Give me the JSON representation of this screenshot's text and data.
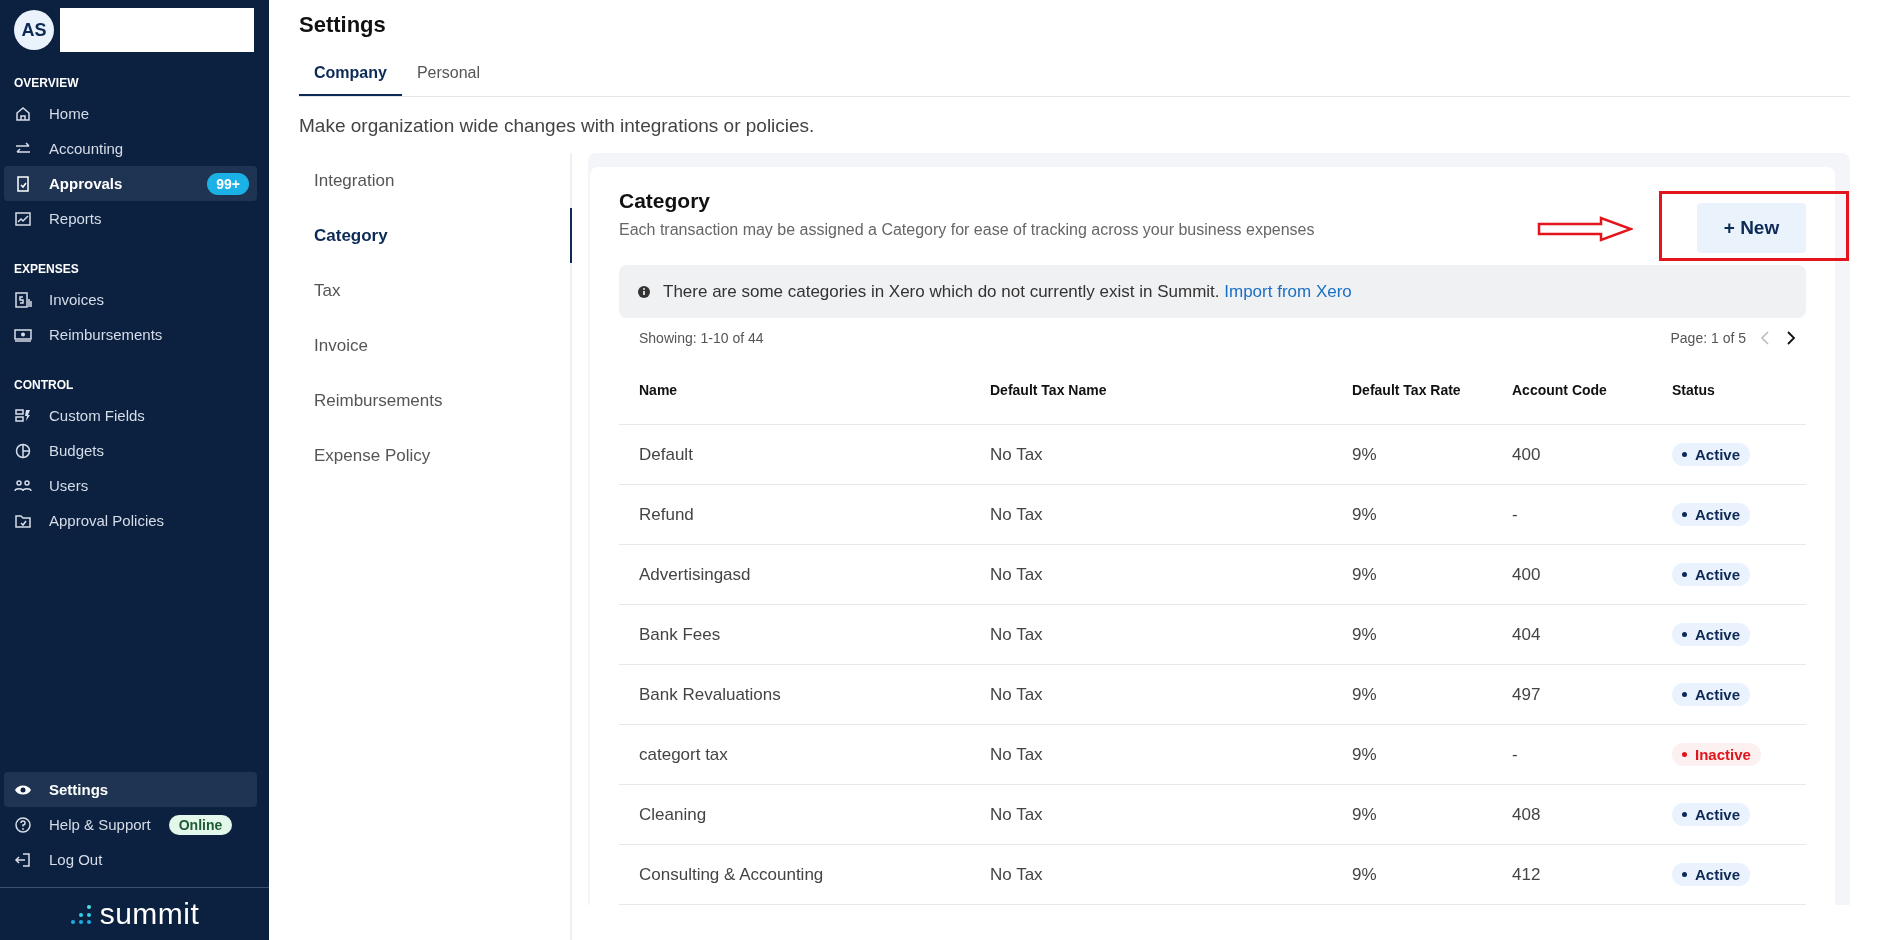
{
  "sidebar": {
    "user": {
      "initials": "AS"
    },
    "sections": [
      {
        "title": "OVERVIEW",
        "items": [
          {
            "label": "Home",
            "selected": false
          },
          {
            "label": "Accounting",
            "selected": false
          },
          {
            "label": "Approvals",
            "selected": true,
            "badge": "99+"
          },
          {
            "label": "Reports",
            "selected": false
          }
        ]
      },
      {
        "title": "EXPENSES",
        "items": [
          {
            "label": "Invoices",
            "selected": false
          },
          {
            "label": "Reimbursements",
            "selected": false
          }
        ]
      },
      {
        "title": "CONTROL",
        "items": [
          {
            "label": "Custom Fields",
            "selected": false
          },
          {
            "label": "Budgets",
            "selected": false
          },
          {
            "label": "Users",
            "selected": false
          },
          {
            "label": "Approval Policies",
            "selected": false
          }
        ]
      }
    ],
    "bottom_items": [
      {
        "label": "Settings",
        "selected": true
      },
      {
        "label": "Help & Support",
        "selected": false,
        "badge": "Online"
      },
      {
        "label": "Log Out",
        "selected": false
      }
    ],
    "logo": "summit"
  },
  "page": {
    "title": "Settings",
    "tabs": [
      {
        "label": "Company",
        "selected": true
      },
      {
        "label": "Personal",
        "selected": false
      }
    ],
    "subtitle": "Make organization wide changes with integrations or policies.",
    "settings_nav": [
      {
        "label": "Integration",
        "selected": false
      },
      {
        "label": "Category",
        "selected": true
      },
      {
        "label": "Tax",
        "selected": false
      },
      {
        "label": "Invoice",
        "selected": false
      },
      {
        "label": "Reimbursements",
        "selected": false
      },
      {
        "label": "Expense Policy",
        "selected": false
      }
    ],
    "category": {
      "title": "Category",
      "description": "Each transaction may be assigned a Category for ease of tracking across your business expenses",
      "new_button": "+ New",
      "notice": {
        "text": "There are some categories in Xero which do not currently exist in Summit.",
        "link": "Import from Xero"
      },
      "showing": "Showing: 1-10 of 44",
      "page_info": "Page: 1 of 5",
      "table": {
        "columns": [
          "Name",
          "Default Tax Name",
          "Default Tax Rate",
          "Account Code",
          "Status"
        ],
        "rows": [
          {
            "name": "Default",
            "tax_name": "No Tax",
            "tax_rate": "9%",
            "account_code": "400",
            "status": {
              "label": "Active",
              "kind": "active"
            }
          },
          {
            "name": "Refund",
            "tax_name": "No Tax",
            "tax_rate": "9%",
            "account_code": "-",
            "status": {
              "label": "Active",
              "kind": "active"
            }
          },
          {
            "name": "Advertisingasd",
            "tax_name": "No Tax",
            "tax_rate": "9%",
            "account_code": "400",
            "status": {
              "label": "Active",
              "kind": "active"
            }
          },
          {
            "name": "Bank Fees",
            "tax_name": "No Tax",
            "tax_rate": "9%",
            "account_code": "404",
            "status": {
              "label": "Active",
              "kind": "active"
            }
          },
          {
            "name": "Bank Revaluations",
            "tax_name": "No Tax",
            "tax_rate": "9%",
            "account_code": "497",
            "status": {
              "label": "Active",
              "kind": "active"
            }
          },
          {
            "name": "categort tax",
            "tax_name": "No Tax",
            "tax_rate": "9%",
            "account_code": "-",
            "status": {
              "label": "Inactive",
              "kind": "inactive"
            }
          },
          {
            "name": "Cleaning",
            "tax_name": "No Tax",
            "tax_rate": "9%",
            "account_code": "408",
            "status": {
              "label": "Active",
              "kind": "active"
            }
          },
          {
            "name": "Consulting & Accounting",
            "tax_name": "No Tax",
            "tax_rate": "9%",
            "account_code": "412",
            "status": {
              "label": "Active",
              "kind": "active"
            }
          }
        ]
      }
    }
  }
}
